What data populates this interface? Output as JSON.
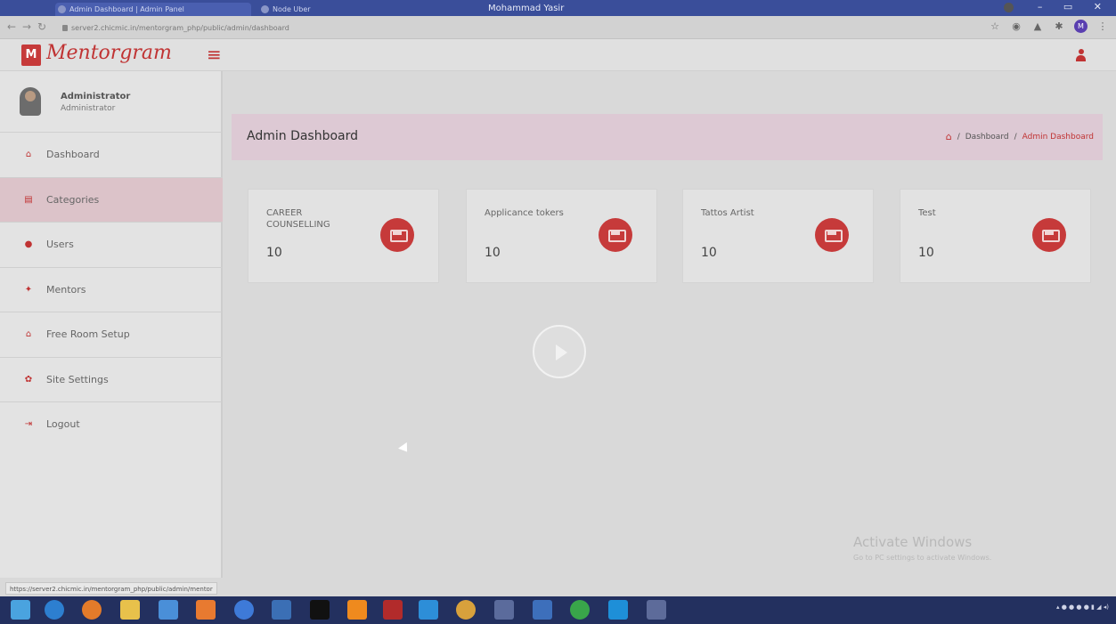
{
  "browser": {
    "tabs": [
      {
        "label": "Admin Dashboard | Admin Panel"
      },
      {
        "label": "Node Uber"
      }
    ],
    "window_title": "Mohammad Yasir",
    "url": "server2.chicmic.in/mentorgram_php/public/admin/dashboard",
    "profile_initial": "M",
    "status_url": "https://server2.chicmic.in/mentorgram_php/public/admin/mentor"
  },
  "header": {
    "logo_mark": "M",
    "logo_text": "Mentorgram",
    "menu_icon": "hamburger-icon",
    "user_icon": "user-icon"
  },
  "sidebar": {
    "profile": {
      "name": "Administrator",
      "role": "Administrator"
    },
    "items": [
      {
        "label": "Dashboard",
        "icon": "dashboard-icon"
      },
      {
        "label": "Categories",
        "icon": "categories-icon",
        "active": true
      },
      {
        "label": "Users",
        "icon": "users-icon"
      },
      {
        "label": "Mentors",
        "icon": "mentors-icon"
      },
      {
        "label": "Free Room Setup",
        "icon": "home-icon"
      },
      {
        "label": "Site Settings",
        "icon": "settings-icon"
      },
      {
        "label": "Logout",
        "icon": "logout-icon"
      }
    ]
  },
  "main": {
    "page_title": "Admin Dashboard",
    "breadcrumb": {
      "home_icon": "home-icon",
      "items": [
        "Dashboard",
        "Admin Dashboard"
      ],
      "separator": "/"
    },
    "cards": [
      {
        "label": "CAREER COUNSELLING",
        "value": "10",
        "icon": "bed-icon"
      },
      {
        "label": "Applicance tokers",
        "value": "10",
        "icon": "bed-icon"
      },
      {
        "label": "Tattos Artist",
        "value": "10",
        "icon": "bed-icon"
      },
      {
        "label": "Test",
        "value": "10",
        "icon": "bed-icon"
      }
    ]
  },
  "watermark": {
    "line1": "Activate Windows",
    "line2": "Go to PC settings to activate Windows."
  },
  "colors": {
    "accent": "#c63a3a",
    "header_band": "#ddc9d4",
    "active_item": "#dcc3c9"
  }
}
